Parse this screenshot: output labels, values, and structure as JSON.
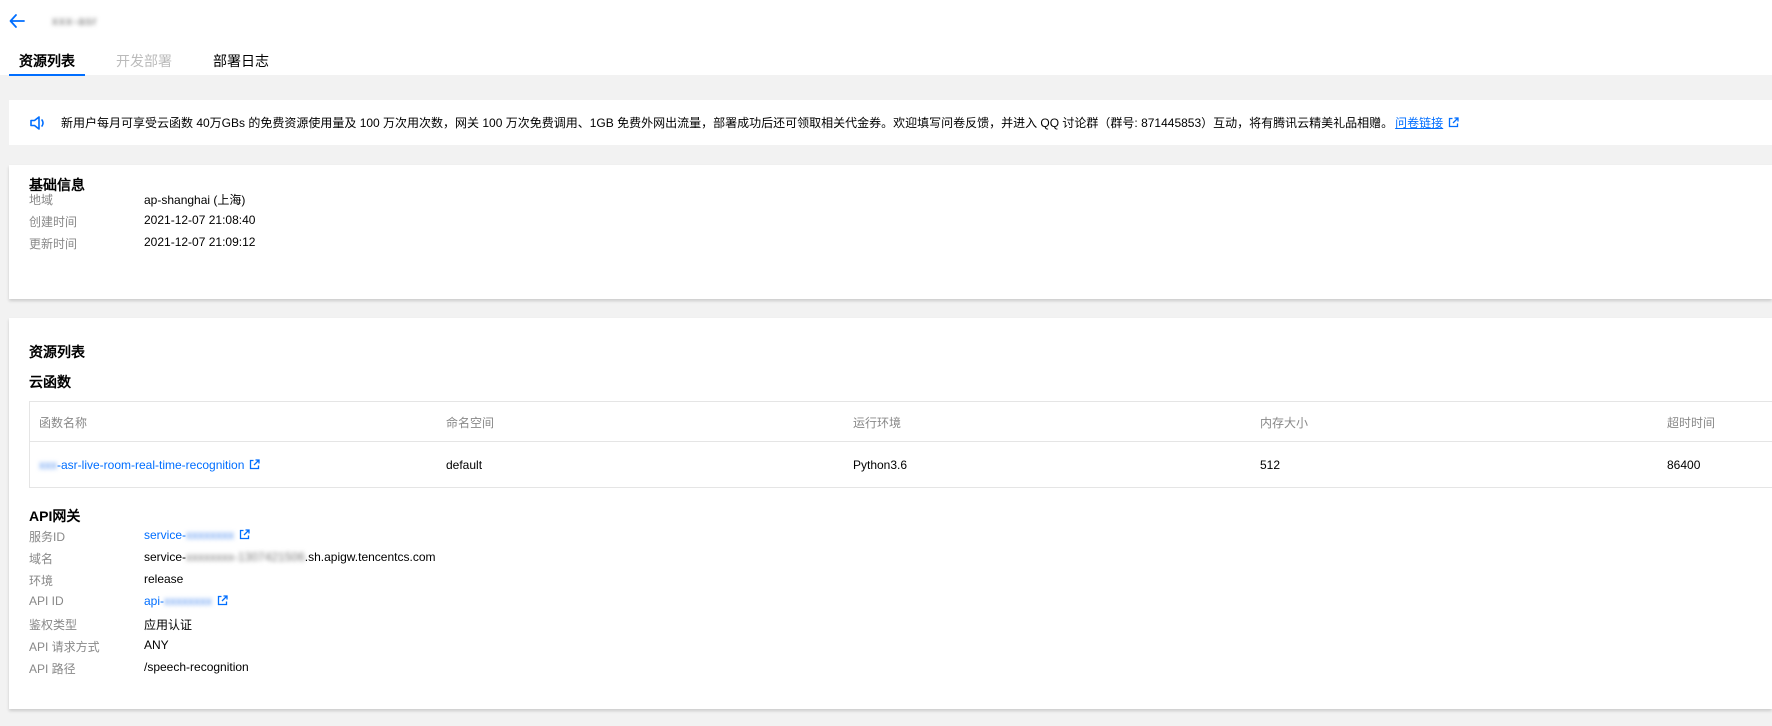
{
  "header": {
    "app_name": "xxx-asr",
    "tabs": [
      {
        "label": "资源列表",
        "state": "active"
      },
      {
        "label": "开发部署",
        "state": "disabled"
      },
      {
        "label": "部署日志",
        "state": "normal"
      }
    ]
  },
  "notice": {
    "text": "新用户每月可享受云函数 40万GBs 的免费资源使用量及 100 万次用次数，网关 100 万次免费调用、1GB  免费外网出流量，部署成功后还可领取相关代金券。欢迎填写问卷反馈，并进入 QQ 讨论群（群号: 871445853）互动，将有腾讯云精美礼品相赠。",
    "link_label": "问卷链接"
  },
  "basic_info": {
    "title": "基础信息",
    "rows": [
      {
        "label": "地域",
        "value": "ap-shanghai (上海)"
      },
      {
        "label": "创建时间",
        "value": "2021-12-07 21:08:40"
      },
      {
        "label": "更新时间",
        "value": "2021-12-07 21:09:12"
      }
    ]
  },
  "resources": {
    "title": "资源列表",
    "scf": {
      "title": "云函数",
      "columns": [
        "函数名称",
        "命名空间",
        "运行环境",
        "内存大小",
        "超时时间"
      ],
      "row": {
        "name_prefix": "xxx",
        "name": "-asr-live-room-real-time-recognition",
        "namespace": "default",
        "runtime": "Python3.6",
        "memory": "512",
        "timeout": "86400"
      }
    },
    "apigw": {
      "title": "API网关",
      "service_id": {
        "label": "服务ID",
        "prefix": "service-",
        "hidden": "xxxxxxxx"
      },
      "domain": {
        "label": "域名",
        "prefix": "service-",
        "hidden": "xxxxxxxx-1307421506",
        "suffix": ".sh.apigw.tencentcs.com"
      },
      "env": {
        "label": "环境",
        "value": "release"
      },
      "api_id": {
        "label": "API ID",
        "prefix": "api-",
        "hidden": "xxxxxxxx"
      },
      "auth": {
        "label": "鉴权类型",
        "value": "应用认证"
      },
      "method": {
        "label": "API 请求方式",
        "value": "ANY"
      },
      "path": {
        "label": "API 路径",
        "value": "/speech-recognition"
      }
    }
  },
  "colors": {
    "accent": "#006eff",
    "background": "#f2f2f2",
    "muted": "#888888"
  }
}
